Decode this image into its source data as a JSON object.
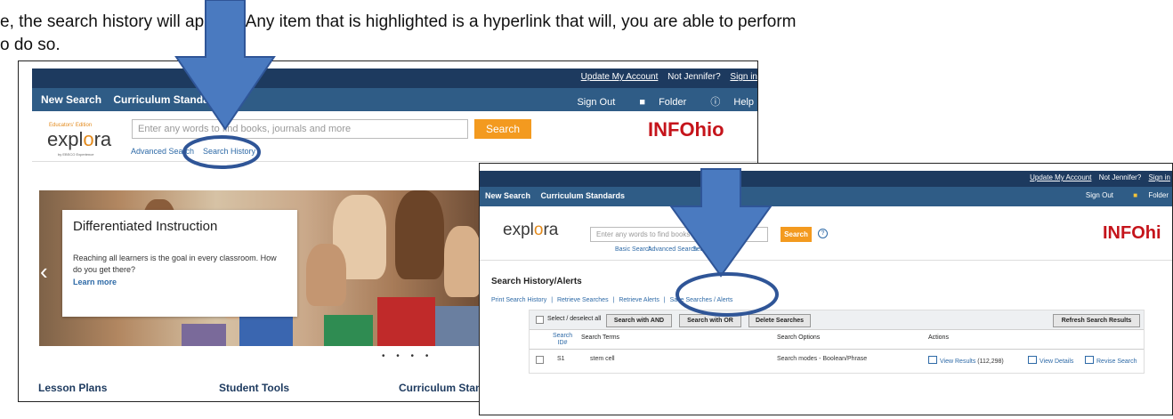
{
  "doc": {
    "line1": "e, the search history will appear. Any item that is highlighted is a hyperlink that will, you are able to perform",
    "line2": "o do so."
  },
  "screen1": {
    "top_links": [
      "Update My Account",
      "Not Jennifer?",
      "Sign in"
    ],
    "nav_left": [
      "New Search",
      "Curriculum Standards"
    ],
    "nav_right": [
      "Sign Out",
      "Folder",
      "Help"
    ],
    "logo_edition": "Educators' Edition",
    "logo_word": "explora",
    "logo_sub": "by EBSCO Experience",
    "search_placeholder": "Enter any words to find books, journals and more",
    "search_button": "Search",
    "brand": "INFOhio",
    "advanced_search": "Advanced Search",
    "search_history": "Search History",
    "hero_title": "Differentiated Instruction",
    "hero_body": "Reaching all learners is the goal in every classroom. How do you get there?",
    "hero_link": "Learn more",
    "carousel_dots": "• • • •",
    "bottom_links": [
      "Lesson Plans",
      "Student Tools",
      "Curriculum Stand"
    ]
  },
  "screen2": {
    "top_links": [
      "Update My Account",
      "Not Jennifer?",
      "Sign in"
    ],
    "nav_left": [
      "New Search",
      "Curriculum Standards"
    ],
    "nav_right": [
      "Sign Out",
      "Folder"
    ],
    "logo_word": "explora",
    "search_placeholder": "Enter any words to find books",
    "search_button": "Search",
    "brand": "INFOhi",
    "sub_links": [
      "Basic Search",
      "Advanced Search",
      "Sea"
    ],
    "section_title": "Search History/Alerts",
    "history_links": [
      "Print Search History",
      "|",
      "Retrieve Searches",
      "|",
      "Retrieve Alerts",
      "|",
      "Save Searches / Alerts"
    ],
    "select_all": "Select / deselect all",
    "btn_and": "Search with AND",
    "btn_or": "Search with OR",
    "btn_delete": "Delete Searches",
    "btn_refresh": "Refresh Search Results",
    "col_id": "Search ID#",
    "col_terms": "Search Terms",
    "col_options": "Search Options",
    "col_actions": "Actions",
    "row": {
      "id": "S1",
      "terms": "stem cell",
      "options": "Search modes - Boolean/Phrase",
      "view_results": "View Results",
      "count": "(112,298)",
      "view_details": "View Details",
      "revise": "Revise Search"
    }
  },
  "colors": {
    "header_dark": "#1d3a5f",
    "header_nav": "#2f5c86",
    "accent_orange": "#f39a1f",
    "brand_red": "#c5141b",
    "arrow_fill": "#4a7ac0",
    "arrow_stroke": "#2f5597",
    "link_blue": "#2e6aa7"
  }
}
